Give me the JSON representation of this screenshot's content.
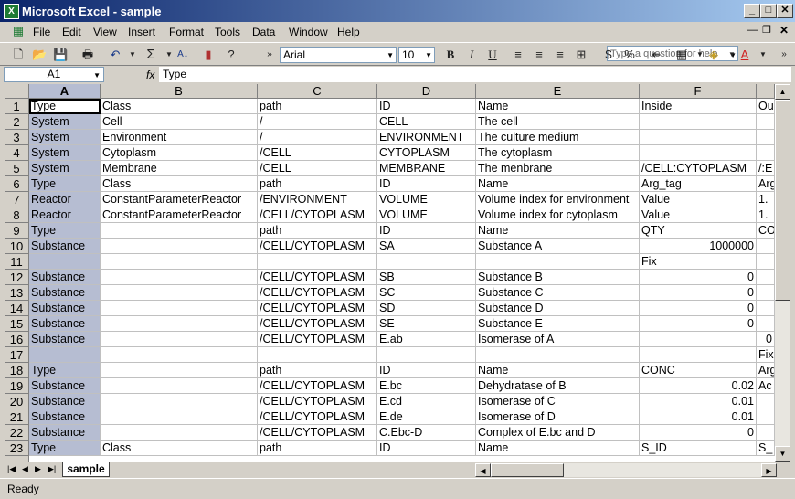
{
  "window": {
    "title": "Microsoft Excel - sample"
  },
  "menu": [
    "File",
    "Edit",
    "View",
    "Insert",
    "Format",
    "Tools",
    "Data",
    "Window",
    "Help"
  ],
  "help_placeholder": "Type a question for help",
  "toolbar": {
    "font_name": "Arial",
    "font_size": "10"
  },
  "formula": {
    "name_box": "A1",
    "fx": "fx",
    "content": "Type"
  },
  "columns": [
    "A",
    "B",
    "C",
    "D",
    "E",
    "F",
    ""
  ],
  "selected_column": "A",
  "rows": [
    [
      "Type",
      "Class",
      "path",
      "ID",
      "Name",
      "Inside",
      "Ou"
    ],
    [
      "System",
      "Cell",
      "/",
      "CELL",
      "The cell",
      "",
      ""
    ],
    [
      "System",
      "Environment",
      "/",
      "ENVIRONMENT",
      "The culture medium",
      "",
      ""
    ],
    [
      "System",
      "Cytoplasm",
      "/CELL",
      "CYTOPLASM",
      "The cytoplasm",
      "",
      ""
    ],
    [
      "System",
      "Membrane",
      "/CELL",
      "MEMBRANE",
      "The menbrane",
      "/CELL:CYTOPLASM",
      "/:E"
    ],
    [
      "Type",
      "Class",
      "path",
      "ID",
      "Name",
      "Arg_tag",
      "Arg"
    ],
    [
      "Reactor",
      "ConstantParameterReactor",
      "/ENVIRONMENT",
      "VOLUME",
      "Volume index for environment",
      "Value",
      "1."
    ],
    [
      "Reactor",
      "ConstantParameterReactor",
      "/CELL/CYTOPLASM",
      "VOLUME",
      "Volume index for cytoplasm",
      "Value",
      "1."
    ],
    [
      "Type",
      "",
      "path",
      "ID",
      "Name",
      "QTY",
      "CO"
    ],
    [
      "Substance",
      "",
      "/CELL/CYTOPLASM",
      "SA",
      "Substance A",
      "1000000",
      ""
    ],
    [
      "",
      "",
      "",
      "",
      "",
      "Fix",
      ""
    ],
    [
      "Substance",
      "",
      "/CELL/CYTOPLASM",
      "SB",
      "Substance B",
      "0",
      ""
    ],
    [
      "Substance",
      "",
      "/CELL/CYTOPLASM",
      "SC",
      "Substance C",
      "0",
      ""
    ],
    [
      "Substance",
      "",
      "/CELL/CYTOPLASM",
      "SD",
      "Substance D",
      "0",
      ""
    ],
    [
      "Substance",
      "",
      "/CELL/CYTOPLASM",
      "SE",
      "Substance E",
      "0",
      ""
    ],
    [
      "Substance",
      "",
      "/CELL/CYTOPLASM",
      "E.ab",
      "Isomerase of A",
      "",
      "0"
    ],
    [
      "",
      "",
      "",
      "",
      "",
      "",
      "Fix"
    ],
    [
      "Type",
      "",
      "path",
      "ID",
      "Name",
      "CONC",
      "Arg"
    ],
    [
      "Substance",
      "",
      "/CELL/CYTOPLASM",
      "E.bc",
      "Dehydratase of B",
      "0.02",
      "Ac"
    ],
    [
      "Substance",
      "",
      "/CELL/CYTOPLASM",
      "E.cd",
      "Isomerase of C",
      "0.01",
      ""
    ],
    [
      "Substance",
      "",
      "/CELL/CYTOPLASM",
      "E.de",
      "Isomerase of D",
      "0.01",
      ""
    ],
    [
      "Substance",
      "",
      "/CELL/CYTOPLASM",
      "C.Ebc-D",
      "Complex of E.bc and D",
      "0",
      ""
    ],
    [
      "Type",
      "Class",
      "path",
      "ID",
      "Name",
      "S_ID",
      "S_"
    ]
  ],
  "numeric_cells": [
    [
      9,
      5
    ],
    [
      11,
      5
    ],
    [
      12,
      5
    ],
    [
      13,
      5
    ],
    [
      14,
      5
    ],
    [
      15,
      6
    ],
    [
      18,
      5
    ],
    [
      19,
      5
    ],
    [
      20,
      5
    ],
    [
      21,
      5
    ]
  ],
  "sheet_tab": "sample",
  "status": "Ready"
}
